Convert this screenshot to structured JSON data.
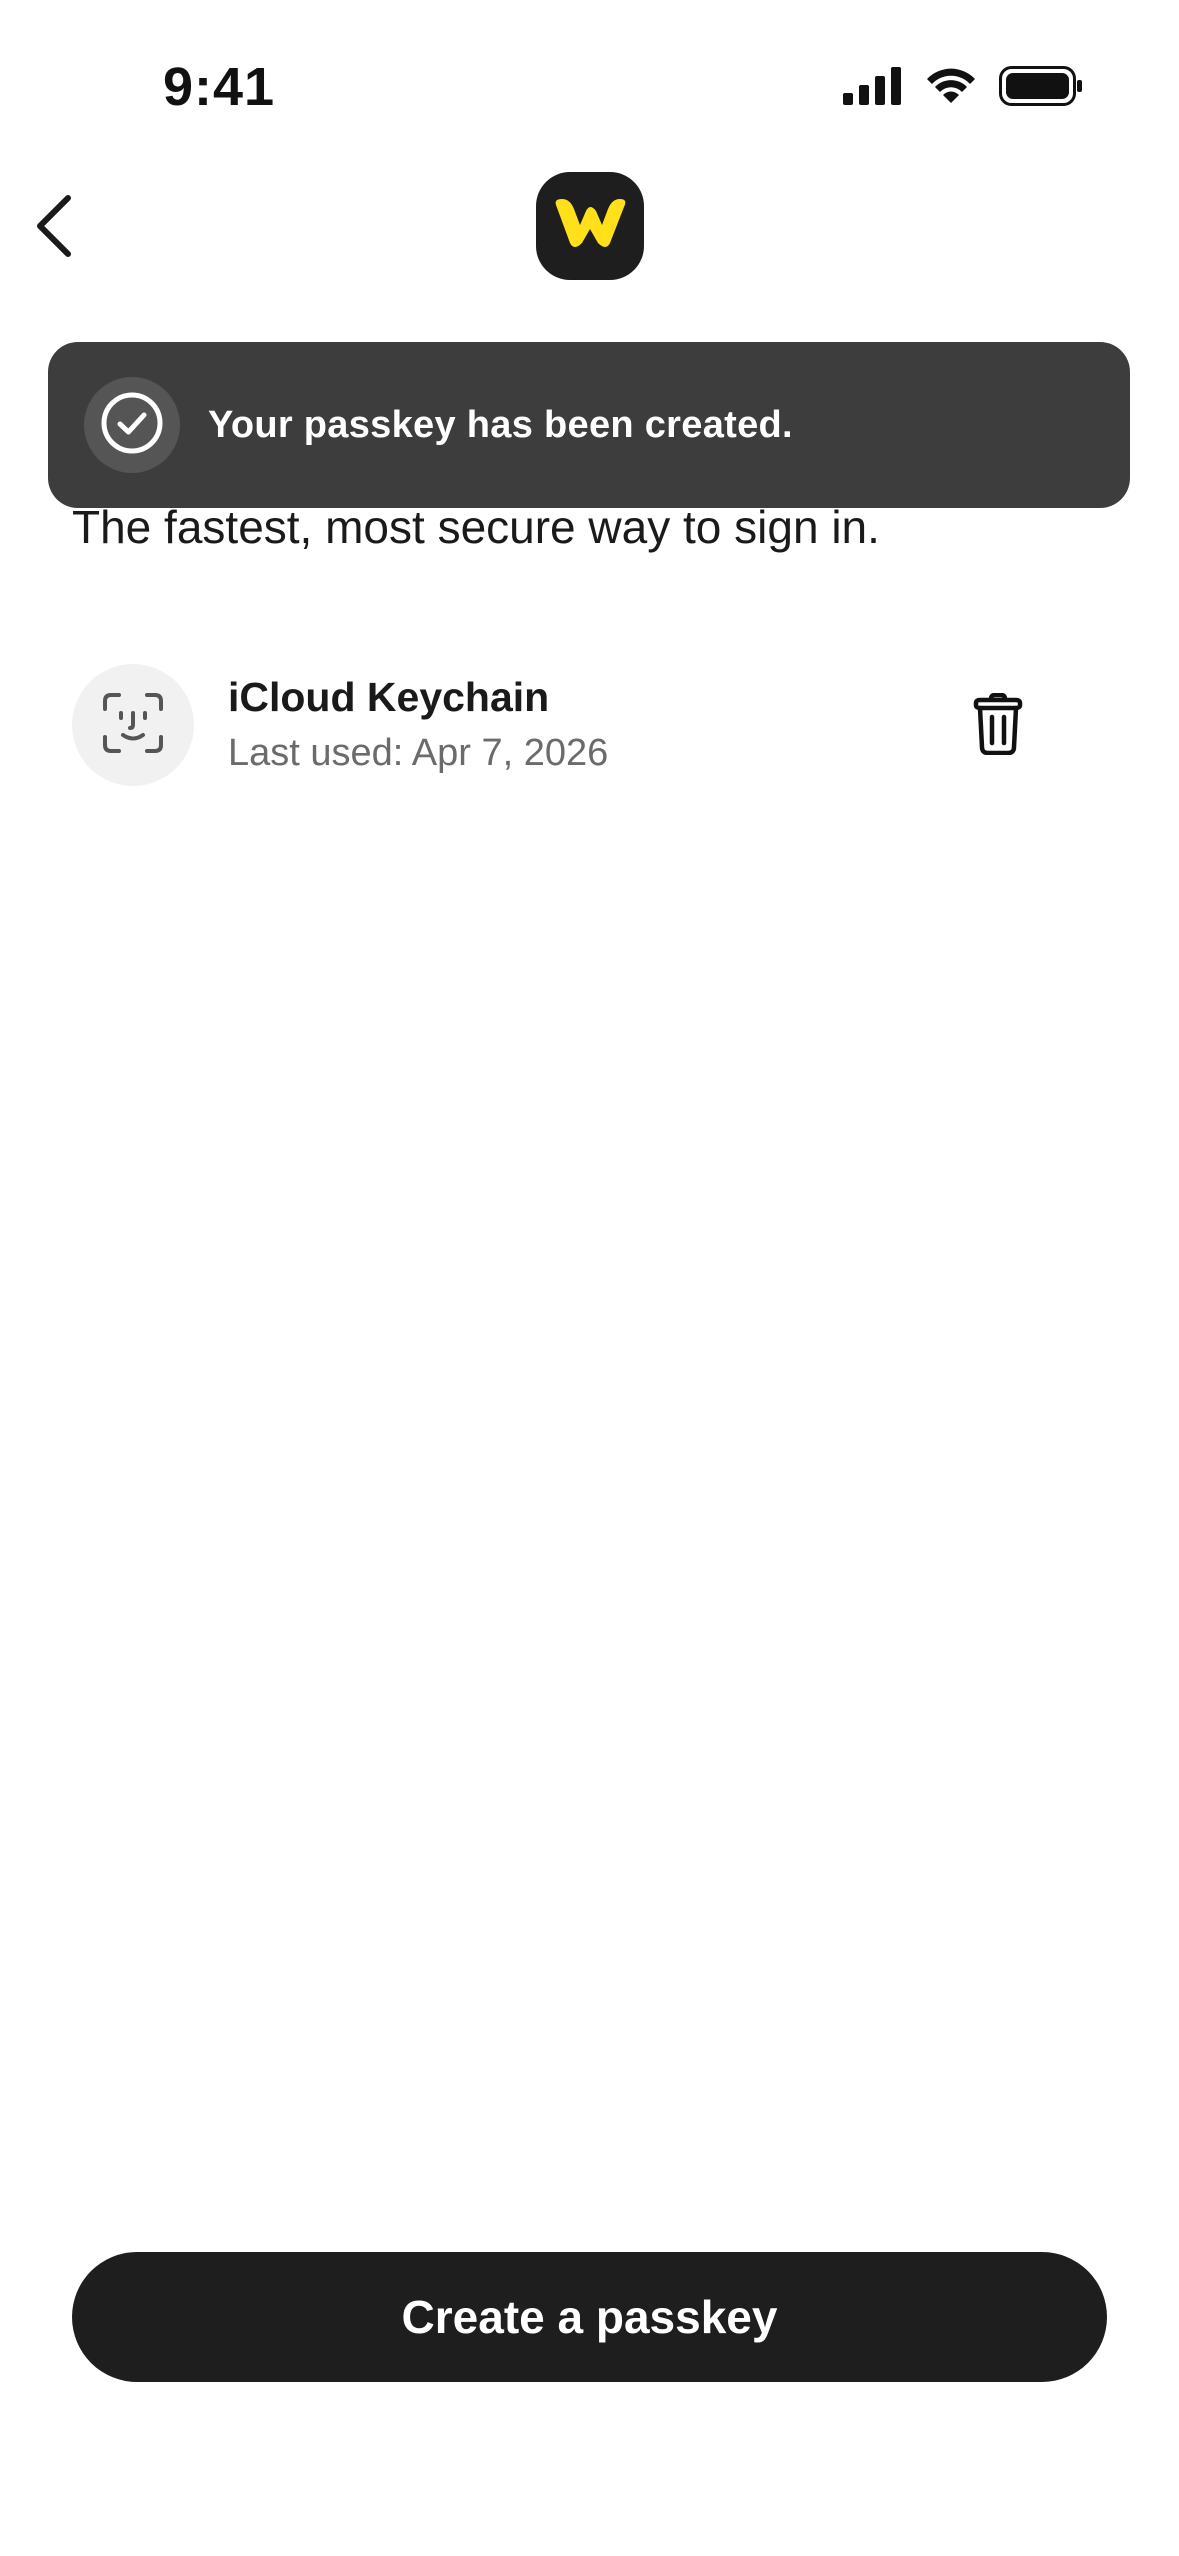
{
  "status_bar": {
    "time": "9:41",
    "icons": [
      "cellular-signal-icon",
      "wifi-icon",
      "battery-icon"
    ]
  },
  "nav": {
    "back_icon": "chevron-left-icon",
    "logo_icon": "app-logo-icon",
    "logo_colors": {
      "background": "#1e1e1e",
      "mark": "#ffe01b"
    }
  },
  "toast": {
    "icon": "check-circle-icon",
    "message": "Your passkey has been created."
  },
  "subtitle": "The fastest, most secure way to sign in.",
  "passkeys": [
    {
      "icon": "face-id-icon",
      "name": "iCloud Keychain",
      "last_used": "Last used: Apr 7, 2026",
      "delete_icon": "trash-icon"
    }
  ],
  "cta": {
    "label": "Create a passkey"
  },
  "colors": {
    "background": "#ffffff",
    "toast_background": "#3d3d3d",
    "button_background": "#1e1e1e",
    "secondary_text": "#6b6b6b"
  }
}
